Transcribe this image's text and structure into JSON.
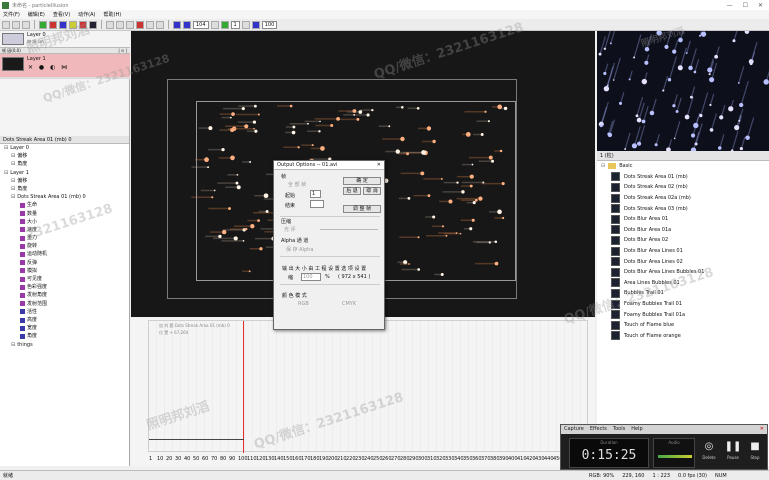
{
  "app": {
    "title": "未命名 - particleIllusion"
  },
  "menu": [
    "文件(F)",
    "编辑(E)",
    "查看(V)",
    "动作(A)",
    "帮助(H)"
  ],
  "toolbar": {
    "frame": "104",
    "step": "1",
    "fps": "100"
  },
  "layers": {
    "top": {
      "name": "Layer 0",
      "sub": "物 场 Lm."
    },
    "header": "帧 因(0,0)",
    "corner": "| ⊙ |",
    "selected": {
      "name": "Layer 1"
    }
  },
  "tree": {
    "header": "Dots Streak Area 01 (mb) 0",
    "items": [
      {
        "label": "Layer 0",
        "indent": 0,
        "sq": ""
      },
      {
        "label": "偏移",
        "indent": 1,
        "sq": ""
      },
      {
        "label": "角度",
        "indent": 1,
        "sq": ""
      },
      {
        "label": "Layer 1",
        "indent": 0,
        "sq": ""
      },
      {
        "label": "偏移",
        "indent": 1,
        "sq": ""
      },
      {
        "label": "角度",
        "indent": 1,
        "sq": ""
      },
      {
        "label": "Dots Streak Area 01 (mb) 0",
        "indent": 1,
        "sq": ""
      },
      {
        "label": "生命",
        "indent": 2,
        "sq": "#9a3aa9"
      },
      {
        "label": "数量",
        "indent": 2,
        "sq": "#9a3aa9"
      },
      {
        "label": "大小",
        "indent": 2,
        "sq": "#9a3aa9"
      },
      {
        "label": "速度",
        "indent": 2,
        "sq": "#9a3aa9"
      },
      {
        "label": "重力",
        "indent": 2,
        "sq": "#9a3aa9"
      },
      {
        "label": "旋转",
        "indent": 2,
        "sq": "#9a3aa9"
      },
      {
        "label": "运动随机",
        "indent": 2,
        "sq": "#9a3aa9"
      },
      {
        "label": "反弹",
        "indent": 2,
        "sq": "#9a3aa9"
      },
      {
        "label": "模拟",
        "indent": 2,
        "sq": "#9a3aa9"
      },
      {
        "label": "可见度",
        "indent": 2,
        "sq": "#9a3aa9"
      },
      {
        "label": "色彩强度",
        "indent": 2,
        "sq": "#9a3aa9"
      },
      {
        "label": "发射角度",
        "indent": 2,
        "sq": "#9a3aa9"
      },
      {
        "label": "发射范围",
        "indent": 2,
        "sq": "#9a3aa9"
      },
      {
        "label": "活性",
        "indent": 2,
        "sq": "#3a3aa9"
      },
      {
        "label": "高度",
        "indent": 2,
        "sq": "#3a3aa9"
      },
      {
        "label": "宽度",
        "indent": 2,
        "sq": "#3a3aa9"
      },
      {
        "label": "角度",
        "indent": 2,
        "sq": "#3a3aa9"
      },
      {
        "label": "things",
        "indent": 1,
        "sq": ""
      }
    ]
  },
  "library": {
    "header": "1 (粒)",
    "folder": "Basic",
    "items": [
      "Dots Streak Area 01 (mb)",
      "Dots Streak Area 02 (mb)",
      "Dots Streak Area 02a (mb)",
      "Dots Streak Area 03 (mb)",
      "Dots Blur Area 01",
      "Dots Blur Area 01a",
      "Dots Blur Area 02",
      "Dots Blur Area Lines 01",
      "Dots Blur Area Lines 02",
      "Dots Blur Area Lines Bubbles 01",
      "Area Lines Bubbles 01",
      "Bubbles Trail 01",
      "Foamy Bubbles Trail 01",
      "Foamy Bubbles Trail 01a",
      "Touch of Flame blue",
      "Touch of Flame orange"
    ]
  },
  "timeline": {
    "line1": "加 刘 题 Dots Streak Area 01 (mb) 0",
    "line2": "位 置 + 67,264",
    "current_frame": "104"
  },
  "ruler": [
    "1",
    "10",
    "20",
    "30",
    "40",
    "50",
    "60",
    "70",
    "80",
    "90",
    "100",
    "110",
    "120",
    "130",
    "140",
    "150",
    "160",
    "170",
    "180",
    "190",
    "200",
    "210",
    "220",
    "230",
    "240",
    "250",
    "260",
    "270",
    "280",
    "290",
    "300",
    "310",
    "320",
    "330",
    "340",
    "350",
    "360",
    "370",
    "380",
    "390",
    "400",
    "410",
    "420",
    "430",
    "440",
    "450",
    "460",
    "470",
    "480"
  ],
  "dialog": {
    "title": "Output Options -- 01.avi",
    "frame_section": "帧",
    "all_frames": "全 部 帧",
    "start_label": "起始",
    "start_val": "1",
    "end_label": "结束",
    "btn_ok": "确 定",
    "btn_back": "后 退",
    "btn_cancel": "取 消",
    "btn_adjust": "调 整 帧",
    "compress": "压缩",
    "light": "光 评",
    "alpha": "Alpha 通 道",
    "keep_alpha": "保 存 Alpha",
    "output_size": "输 出 大 小 由 工 程 设 置 选 项 设 置",
    "scale_label": "缩",
    "scale_val": "100",
    "scale_unit": "%",
    "dims": "( 972 x 541 )",
    "color_mode": "颜 色 模 式",
    "rgb": "RGB",
    "cmyk": "CMYK"
  },
  "capture": {
    "menu": [
      "Capture",
      "Effects",
      "Tools",
      "Help"
    ],
    "duration_label": "Duration",
    "time": "0:15:25",
    "audio_label": "Audio",
    "delete": "Delete",
    "pause": "Pause",
    "stop": "Stop"
  },
  "status": {
    "left": "就绪",
    "mid": "RGB: 90%",
    "coord": "229, 160",
    "zoom": "1 : 223",
    "fps": "0.0 fps (30)",
    "num": "NUM"
  },
  "watermarks": [
    "照明邦刘滔",
    "QQ/微信：2321163128",
    "照明邦刘滔",
    "QQ/微信：2321163128",
    "2321163128",
    "照明邦刘滔",
    "QQ/微信：2321163128"
  ]
}
